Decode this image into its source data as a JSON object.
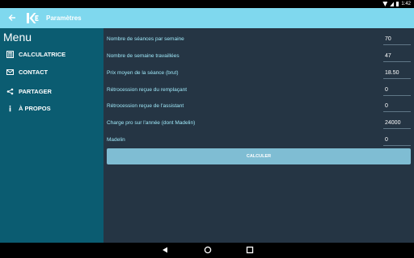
{
  "status_bar": {
    "time": "1:42",
    "icons": [
      "wifi-icon",
      "signal-icon",
      "battery-icon"
    ]
  },
  "app_bar": {
    "title": "Paramètres",
    "back_icon": "arrow-left-icon",
    "logo_icon": "app-logo-icon",
    "color": "#7fd8ee"
  },
  "drawer": {
    "title": "Menu",
    "color": "#0b5c71",
    "items": [
      {
        "label": "CALCULATRICE",
        "icon": "calculator-icon"
      },
      {
        "label": "CONTACT",
        "icon": "mail-icon"
      },
      {
        "label": "PARTAGER",
        "icon": "share-icon"
      },
      {
        "label": "À PROPOS",
        "icon": "info-icon"
      }
    ]
  },
  "settings": {
    "background": "#253544",
    "label_color": "#9fe8f8",
    "rows": [
      {
        "label": "Nombre de séances par semaine",
        "value": "70"
      },
      {
        "label": "Nombre de semaine travaillées",
        "value": "47"
      },
      {
        "label": "Prix moyen de la séance (brut)",
        "value": "18.50"
      },
      {
        "label": "Rétrocession reçue du remplaçant",
        "value": "0"
      },
      {
        "label": "Rétrocession reçue de l'assistant",
        "value": "0"
      },
      {
        "label": "Charge pro sur l'année (dont Madelin)",
        "value": "24000"
      },
      {
        "label": "Madelin",
        "value": "0"
      }
    ],
    "button_label": "CALCULER"
  },
  "nav_bar": {
    "icons": [
      "nav-back-icon",
      "nav-home-icon",
      "nav-recent-icon"
    ]
  }
}
